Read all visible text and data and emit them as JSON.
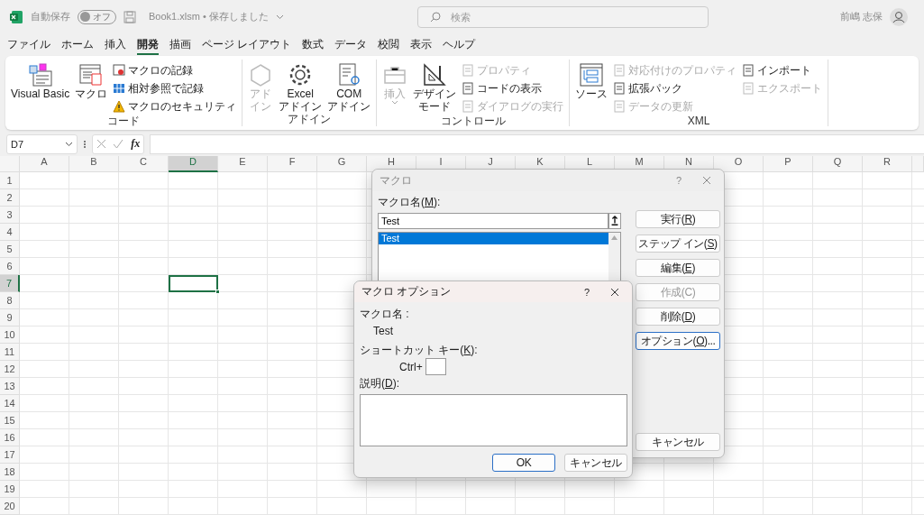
{
  "title_bar": {
    "autosave_label": "自動保存",
    "autosave_toggle": {
      "label": "オフ",
      "on": false
    },
    "document_title": "Book1.xlsm • 保存しました",
    "search": {
      "placeholder": "検索"
    },
    "user_name": "前嶋 志保"
  },
  "tabs": [
    {
      "label": "ファイル",
      "selected": false
    },
    {
      "label": "ホーム",
      "selected": false
    },
    {
      "label": "挿入",
      "selected": false
    },
    {
      "label": "開発",
      "selected": true
    },
    {
      "label": "描画",
      "selected": false
    },
    {
      "label": "ページ レイアウト",
      "selected": false
    },
    {
      "label": "数式",
      "selected": false
    },
    {
      "label": "データ",
      "selected": false
    },
    {
      "label": "校閲",
      "selected": false
    },
    {
      "label": "表示",
      "selected": false
    },
    {
      "label": "ヘルプ",
      "selected": false
    }
  ],
  "ribbon": {
    "groups": [
      {
        "label": "コード",
        "items": [
          {
            "kind": "large",
            "lines": [
              "Visual Basic"
            ],
            "disabled": false
          },
          {
            "kind": "large",
            "lines": [
              "マクロ"
            ],
            "disabled": false
          },
          {
            "kind": "stack",
            "items": [
              {
                "label": "マクロの記録",
                "disabled": false
              },
              {
                "label": "相対参照で記録",
                "disabled": false
              },
              {
                "label": "マクロのセキュリティ",
                "disabled": false
              }
            ]
          }
        ]
      },
      {
        "label": "アドイン",
        "items": [
          {
            "kind": "large",
            "lines": [
              "アド",
              "イン"
            ],
            "disabled": true
          },
          {
            "kind": "large",
            "lines": [
              "Excel",
              "アドイン"
            ],
            "disabled": false
          },
          {
            "kind": "large",
            "lines": [
              "COM",
              "アドイン"
            ],
            "disabled": false
          }
        ]
      },
      {
        "label": "コントロール",
        "items": [
          {
            "kind": "menu",
            "lines": [
              "挿入"
            ],
            "disabled": true
          },
          {
            "kind": "large",
            "lines": [
              "デザイン",
              "モード"
            ],
            "disabled": false
          },
          {
            "kind": "stack",
            "items": [
              {
                "label": "プロパティ",
                "disabled": true
              },
              {
                "label": "コードの表示",
                "disabled": false
              },
              {
                "label": "ダイアログの実行",
                "disabled": true
              }
            ]
          }
        ]
      },
      {
        "label": "XML",
        "items": [
          {
            "kind": "large",
            "lines": [
              "ソース"
            ],
            "disabled": false
          },
          {
            "kind": "stack",
            "items": [
              {
                "label": "対応付けのプロパティ",
                "disabled": true
              },
              {
                "label": "拡張パック",
                "disabled": false
              },
              {
                "label": "データの更新",
                "disabled": true
              }
            ]
          },
          {
            "kind": "stack",
            "items": [
              {
                "label": "インポート",
                "disabled": false
              },
              {
                "label": "エクスポート",
                "disabled": true
              }
            ]
          }
        ]
      }
    ]
  },
  "formula_bar": {
    "name_box": "D7",
    "fx": "fx"
  },
  "sheet": {
    "columns": [
      {
        "label": "A",
        "selected": false
      },
      {
        "label": "B",
        "selected": false
      },
      {
        "label": "C",
        "selected": false
      },
      {
        "label": "D",
        "selected": true
      },
      {
        "label": "E",
        "selected": false
      },
      {
        "label": "F",
        "selected": false
      },
      {
        "label": "G",
        "selected": false
      },
      {
        "label": "H",
        "selected": false
      },
      {
        "label": "I",
        "selected": false
      },
      {
        "label": "J",
        "selected": false
      },
      {
        "label": "K",
        "selected": false
      },
      {
        "label": "L",
        "selected": false
      },
      {
        "label": "M",
        "selected": false
      },
      {
        "label": "N",
        "selected": false
      },
      {
        "label": "O",
        "selected": false
      },
      {
        "label": "P",
        "selected": false
      },
      {
        "label": "Q",
        "selected": false
      },
      {
        "label": "R",
        "selected": false
      }
    ],
    "rows": [
      {
        "label": "1",
        "selected": false
      },
      {
        "label": "2",
        "selected": false
      },
      {
        "label": "3",
        "selected": false
      },
      {
        "label": "4",
        "selected": false
      },
      {
        "label": "5",
        "selected": false
      },
      {
        "label": "6",
        "selected": false
      },
      {
        "label": "7",
        "selected": true
      },
      {
        "label": "8",
        "selected": false
      },
      {
        "label": "9",
        "selected": false
      },
      {
        "label": "10",
        "selected": false
      },
      {
        "label": "11",
        "selected": false
      },
      {
        "label": "12",
        "selected": false
      },
      {
        "label": "13",
        "selected": false
      },
      {
        "label": "14",
        "selected": false
      },
      {
        "label": "15",
        "selected": false
      },
      {
        "label": "16",
        "selected": false
      },
      {
        "label": "17",
        "selected": false
      },
      {
        "label": "18",
        "selected": false
      },
      {
        "label": "19",
        "selected": false
      },
      {
        "label": "20",
        "selected": false
      }
    ]
  },
  "macro_dialog": {
    "title": "マクロ",
    "help": "?",
    "name_label": [
      "マクロ名(",
      "M",
      "):"
    ],
    "name_value": "Test",
    "macros": [
      {
        "label": "Test",
        "selected": true
      }
    ],
    "buttons": [
      {
        "label": [
          "実行(",
          "R",
          ")"
        ],
        "disabled": false,
        "focused": false
      },
      {
        "label": [
          "ステップ イン(",
          "S",
          ")"
        ],
        "disabled": false,
        "focused": false
      },
      {
        "label": [
          "編集(",
          "E",
          ")"
        ],
        "disabled": false,
        "focused": false
      },
      {
        "label": [
          "作成(C)"
        ],
        "disabled": true,
        "focused": false
      },
      {
        "label": [
          "削除(",
          "D",
          ")"
        ],
        "disabled": false,
        "focused": false
      },
      {
        "label": [
          "オプション(",
          "O",
          ")..."
        ],
        "disabled": false,
        "focused": true
      }
    ],
    "cancel_button": "キャンセル"
  },
  "options_dialog": {
    "title": "マクロ オプション",
    "help": "?",
    "name_label": "マクロ名 :",
    "macro_name": "Test",
    "shortcut_label": [
      "ショートカット キー(",
      "K",
      "):"
    ],
    "ctrl_label": "Ctrl+",
    "description_label": [
      "説明(",
      "D",
      "):"
    ],
    "ok_button": {
      "label": "OK",
      "focused": true
    },
    "cancel_button": {
      "label": "キャンセル",
      "focused": false
    }
  }
}
